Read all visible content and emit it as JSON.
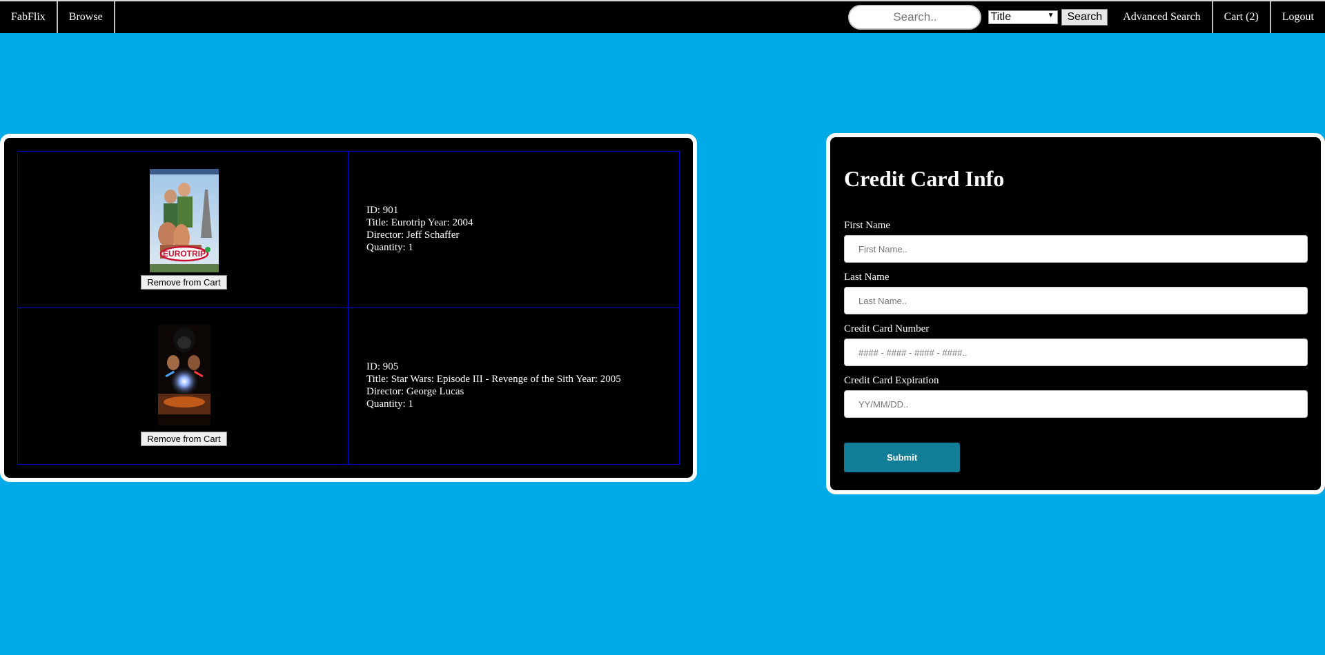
{
  "nav": {
    "brand": "FabFlix",
    "browse": "Browse",
    "search_placeholder": "Search..",
    "search_type_selected": "Title",
    "search_button": "Search",
    "advanced_search": "Advanced Search",
    "cart": "Cart (2)",
    "logout": "Logout"
  },
  "cart": {
    "items": [
      {
        "id_line": "ID: 901",
        "title_line": "Title: Eurotrip Year: 2004",
        "director_line": "Director: Jeff Schaffer",
        "quantity_line": "Quantity: 1",
        "remove_label": "Remove from Cart",
        "poster_text": "EUROTRIP"
      },
      {
        "id_line": "ID: 905",
        "title_line": "Title: Star Wars: Episode III - Revenge of the Sith Year: 2005",
        "director_line": "Director: George Lucas",
        "quantity_line": "Quantity: 1",
        "remove_label": "Remove from Cart"
      }
    ]
  },
  "credit_card": {
    "title": "Credit Card Info",
    "first_name_label": "First Name",
    "first_name_placeholder": "First Name..",
    "last_name_label": "Last Name",
    "last_name_placeholder": "Last Name..",
    "card_number_label": "Credit Card Number",
    "card_number_placeholder": "#### - #### - #### - ####..",
    "expiration_label": "Credit Card Expiration",
    "expiration_placeholder": "YY/MM/DD..",
    "submit_label": "Submit"
  },
  "colors": {
    "page_background": "#00aae6",
    "panel_background": "#000000",
    "table_border": "#0000d0",
    "submit_button": "#127d96"
  }
}
